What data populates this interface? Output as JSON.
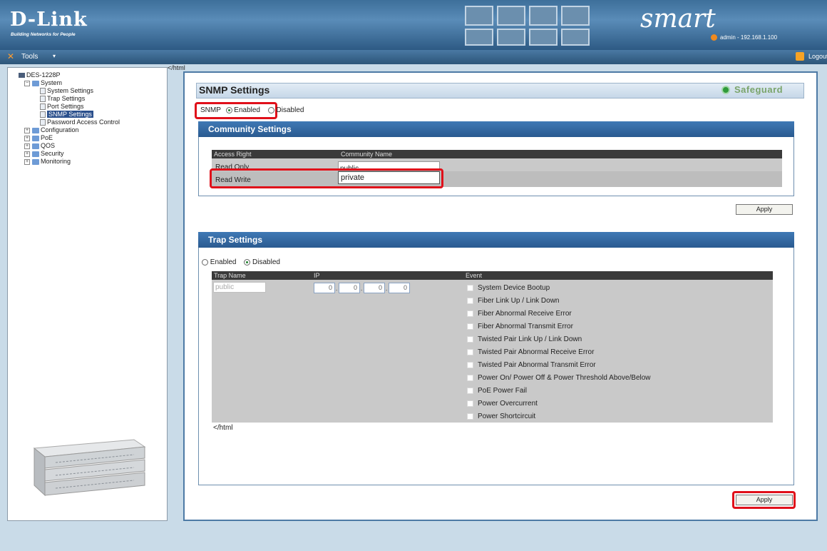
{
  "header": {
    "brand": "D-Link",
    "tagline": "Building Networks for People",
    "product_word": "smart",
    "user_info": "admin - 192.168.1.100",
    "logout_label": "Logout"
  },
  "toolbar": {
    "tools_label": "Tools",
    "tools_dropdown": "▾"
  },
  "sidebar": {
    "device": "DES-1228P",
    "system_label": "System",
    "system_children": [
      "System Settings",
      "Trap Settings",
      "Port Settings",
      "SNMP Settings",
      "Password Access Control"
    ],
    "other_folders": [
      "Configuration",
      "PoE",
      "QOS",
      "Security",
      "Monitoring"
    ],
    "selected": "SNMP Settings"
  },
  "stray_html_top": "</html",
  "main": {
    "title": "SNMP Settings",
    "safeguard": "Safeguard",
    "snmp_label": "SNMP",
    "enabled_label": "Enabled",
    "disabled_label": "Disabled",
    "snmp_state": "Enabled",
    "community": {
      "section_title": "Community Settings",
      "headers": [
        "Access Right",
        "Community Name"
      ],
      "rows": [
        {
          "right": "Read Only",
          "name": "public"
        },
        {
          "right": "Read Write",
          "name": "private"
        }
      ],
      "apply_label": "Apply"
    },
    "trap": {
      "section_title": "Trap Settings",
      "enabled_label": "Enabled",
      "disabled_label": "Disabled",
      "state": "Disabled",
      "headers": [
        "Trap Name",
        "IP",
        "Event"
      ],
      "trap_name": "public",
      "ip": [
        "0",
        "0",
        "0",
        "0"
      ],
      "events": [
        "System Device Bootup",
        "Fiber Link Up / Link Down",
        "Fiber Abnormal Receive Error",
        "Fiber Abnormal Transmit Error",
        "Twisted Pair Link Up / Link Down",
        "Twisted Pair Abnormal Receive Error",
        "Twisted Pair Abnormal Transmit Error",
        "Power On/ Power Off & Power Threshold Above/Below",
        "PoE Power Fail",
        "Power Overcurrent",
        "Power Shortcircuit"
      ],
      "stray_html": "</html",
      "apply_label": "Apply"
    }
  },
  "colors": {
    "accent_red": "#e0101a",
    "header_blue": "#2d5a84",
    "section_blue": "#2a5a90"
  }
}
